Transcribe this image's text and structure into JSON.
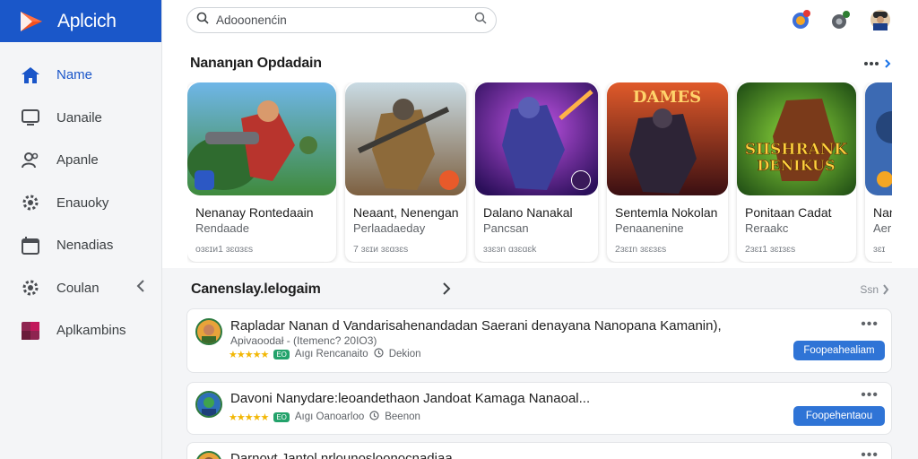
{
  "app": {
    "title": "Aplcich"
  },
  "search": {
    "text": "Adooonenćin"
  },
  "sidebar": {
    "items": [
      {
        "label": "Name",
        "icon": "home-icon",
        "active": true
      },
      {
        "label": "Uanaile",
        "icon": "monitor-icon"
      },
      {
        "label": "Apanle",
        "icon": "users-icon"
      },
      {
        "label": "Enauoky",
        "icon": "gear-icon"
      },
      {
        "label": "Nenadias",
        "icon": "calendar-icon"
      },
      {
        "label": "Coulan",
        "icon": "settings-icon"
      },
      {
        "label": "Aplkambins",
        "icon": "apps-icon"
      }
    ]
  },
  "featured": {
    "title": "Nananȷan Opdadain",
    "cards": [
      {
        "title": "Nenanay Rontedaain",
        "subtitle": "Rendaade",
        "meta": "ᴏɜɛɪᴎ1 ɜɛɑɜɛs"
      },
      {
        "title": "Neaant, Nenengan",
        "subtitle": "Perlaadaeday",
        "meta": "7 ɜɛɪᴎ ɜɛɑɜɛs"
      },
      {
        "title": "Dalano Nanakal",
        "subtitle": "Pancsan",
        "meta": "ɜɜɛɜn ɑɜɛɑɛk"
      },
      {
        "title": "Sentemla Nokolan",
        "subtitle": "Penaanenine",
        "meta": "2ɜɛɪn ɜɛɛɜɛs"
      },
      {
        "title": "Ponitaan Cadat",
        "subtitle": "Reraakc",
        "meta": "2ɜɛɪ1 ɜɛɪɜɛs"
      },
      {
        "title": "Nan",
        "subtitle": "Aer",
        "meta": "ɜɛɪ"
      }
    ]
  },
  "list": {
    "title": "Canenslay.lelogaim",
    "see_all": "Ssn",
    "rows": [
      {
        "title": "Rapladar Nanan d Vandarisahenandadan Saerani denayana Nanopana Kamanin),",
        "subtitle": "Apivaoodał - (Itemenc? 20IO3)",
        "chip": "EO",
        "meta1": "Aıgı  Rencanaito",
        "meta2": "Dekion",
        "button": "Foopeahealiam"
      },
      {
        "title": "Davoni Nanydare:leoandethaon Jandoat Kamaga Nanaoal...",
        "subtitle": "",
        "chip": "EO",
        "meta1": "Aıgı  Oanoarloo",
        "meta2": "Beenon",
        "button": "Foopehentaou"
      },
      {
        "title": "Darnovt Jantol nrlounosloonocnadiaa",
        "subtitle": "",
        "chip": "",
        "meta1": "",
        "meta2": "",
        "button": ""
      }
    ]
  },
  "colors": {
    "brand": "#1a57c9",
    "accent": "#2f74d6",
    "star": "#f2b705",
    "chip": "#23a26b"
  }
}
